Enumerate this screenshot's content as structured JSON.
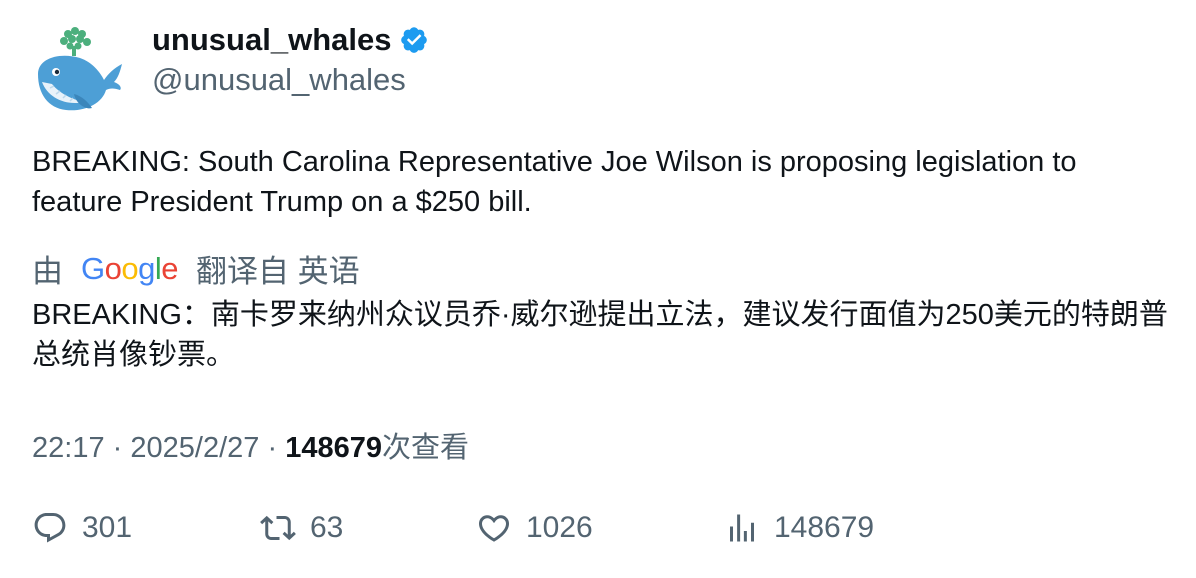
{
  "author": {
    "display_name": "unusual_whales",
    "handle": "@unusual_whales",
    "avatar_icon": "whale-icon",
    "verified_icon": "verified-badge-icon",
    "verified_color": "#1d9bf0"
  },
  "tweet": {
    "text": "BREAKING: South Carolina Representative Joe Wilson is proposing legislation to feature President Trump on a $250 bill."
  },
  "translation": {
    "prefix": "由",
    "provider": "Google",
    "suffix": "翻译自 英语",
    "text": "BREAKING：南卡罗来纳州众议员乔·威尔逊提出立法，建议发行面值为250美元的特朗普总统肖像钞票。"
  },
  "meta": {
    "time": "22:17",
    "separator": "·",
    "date": "2025/2/27",
    "views_count": "148679",
    "views_label": "次查看"
  },
  "actions": {
    "replies": "301",
    "retweets": "63",
    "likes": "1026",
    "views": "148679"
  },
  "colors": {
    "text_primary": "#0f1419",
    "text_secondary": "#536471",
    "accent": "#1d9bf0"
  }
}
